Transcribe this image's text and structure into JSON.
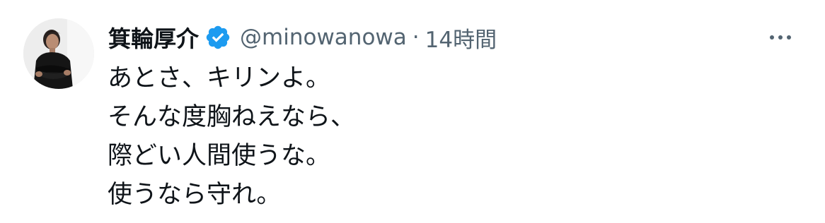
{
  "tweet": {
    "author": {
      "display_name": "箕輪厚介",
      "handle": "@minowanowa",
      "verified": true,
      "avatar_icon": "user-avatar-photo"
    },
    "separator": "·",
    "time": "14時間",
    "more_icon": "more-options-icon",
    "lines": [
      "あとさ、キリンよ。",
      "そんな度胸ねえなら、",
      "際どい人間使うな。",
      "使うなら守れ。"
    ]
  },
  "colors": {
    "text_primary": "#0f1419",
    "text_secondary": "#536471",
    "verified_blue": "#1d9bf0"
  }
}
